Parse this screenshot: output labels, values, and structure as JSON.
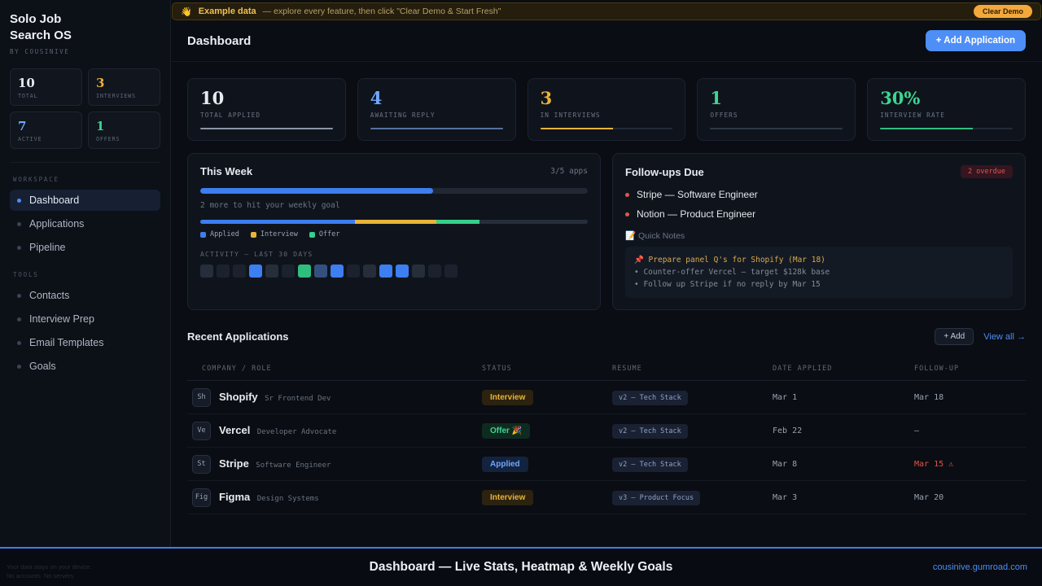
{
  "sidebar": {
    "title_line1": "Solo Job",
    "title_line2": "Search OS",
    "byline": "BY COUSINIVE",
    "stats": [
      {
        "value": "10",
        "label": "TOTAL",
        "color": "#e7eaf0"
      },
      {
        "value": "3",
        "label": "INTERVIEWS",
        "color": "#e8b339"
      },
      {
        "value": "7",
        "label": "ACTIVE",
        "color": "#6ea8fe"
      },
      {
        "value": "1",
        "label": "OFFERS",
        "color": "#3bd68f"
      }
    ],
    "sections": [
      {
        "heading": "WORKSPACE",
        "items": [
          {
            "label": "Dashboard",
            "active": true
          },
          {
            "label": "Applications",
            "active": false
          },
          {
            "label": "Pipeline",
            "active": false
          }
        ]
      },
      {
        "heading": "TOOLS",
        "items": [
          {
            "label": "Contacts",
            "active": false
          },
          {
            "label": "Interview Prep",
            "active": false
          },
          {
            "label": "Email Templates",
            "active": false
          },
          {
            "label": "Goals",
            "active": false
          }
        ]
      }
    ],
    "footnote_line1": "Your data stays on your device.",
    "footnote_line2": "No accounts. No servers."
  },
  "banner": {
    "emoji": "👋",
    "title": "Example data",
    "message": "— explore every feature, then click \"Clear Demo & Start Fresh\"",
    "button": "Clear Demo"
  },
  "header": {
    "title": "Dashboard",
    "add_button": "+ Add Application"
  },
  "stat_cards": [
    {
      "value": "10",
      "label": "TOTAL APPLIED",
      "color": "#e7eaf0",
      "bar_color": "#8b95a5",
      "bar_pct": 100
    },
    {
      "value": "4",
      "label": "AWAITING REPLY",
      "color": "#6ea8fe",
      "bar_color": "#54729e",
      "bar_pct": 100
    },
    {
      "value": "3",
      "label": "IN INTERVIEWS",
      "color": "#e8b339",
      "bar_color": "#e8b339",
      "bar_pct": 55
    },
    {
      "value": "1",
      "label": "OFFERS",
      "color": "#3bd68f",
      "bar_color": "#2d3846",
      "bar_pct": 100
    },
    {
      "value": "30%",
      "label": "INTERVIEW RATE",
      "color": "#3bd68f",
      "bar_color": "#2fbe7e",
      "bar_pct": 70
    }
  ],
  "this_week": {
    "title": "This Week",
    "counter": "3/5 apps",
    "progress_pct": 60,
    "hint": "2 more to hit your weekly goal",
    "breakdown": [
      {
        "color": "#3d7ef0",
        "pct": 40
      },
      {
        "color": "#e8b339",
        "pct": 21
      },
      {
        "color": "#35d08a",
        "pct": 11
      },
      {
        "color": "#262e3b",
        "pct": 28
      }
    ],
    "legend": [
      {
        "label": "Applied",
        "color": "#3d7ef0"
      },
      {
        "label": "Interview",
        "color": "#e8b339"
      },
      {
        "label": "Offer",
        "color": "#35d08a"
      }
    ],
    "activity_label": "ACTIVITY — LAST 30 DAYS",
    "activity_levels": [
      1,
      0,
      0,
      3,
      1,
      0,
      4,
      2,
      3,
      0,
      1,
      3,
      3,
      1,
      0,
      0
    ],
    "activity_palette": {
      "0": "#1c222d",
      "1": "#262e3b",
      "2": "#33507f",
      "3": "#3d7ef0",
      "4": "#2fbe7e"
    }
  },
  "followups": {
    "title": "Follow-ups Due",
    "badge": "2 overdue",
    "items": [
      "Stripe — Software Engineer",
      "Notion — Product Engineer"
    ],
    "notes_title": "📝 Quick Notes",
    "notes": [
      {
        "text": "📌 Prepare panel Q's for Shopify (Mar 18)",
        "highlight": true
      },
      {
        "text": "• Counter-offer Vercel — target $128k base",
        "highlight": false
      },
      {
        "text": "• Follow up Stripe if no reply by Mar 15",
        "highlight": false
      }
    ]
  },
  "recent": {
    "title": "Recent Applications",
    "add_button": "+ Add",
    "view_all": "View all →",
    "columns": [
      "COMPANY / ROLE",
      "STATUS",
      "RESUME",
      "DATE APPLIED",
      "FOLLOW-UP"
    ],
    "rows": [
      {
        "initials": "Sh",
        "company": "Shopify",
        "role": "Sr Frontend Dev",
        "status": "Interview",
        "status_type": "interview",
        "resume": "v2 – Tech Stack",
        "date": "Mar 1",
        "followup": "Mar 18",
        "overdue": false
      },
      {
        "initials": "Ve",
        "company": "Vercel",
        "role": "Developer Advocate",
        "status": "Offer 🎉",
        "status_type": "offer",
        "resume": "v2 – Tech Stack",
        "date": "Feb 22",
        "followup": "—",
        "overdue": false
      },
      {
        "initials": "St",
        "company": "Stripe",
        "role": "Software Engineer",
        "status": "Applied",
        "status_type": "applied",
        "resume": "v2 – Tech Stack",
        "date": "Mar 8",
        "followup": "Mar 15 ⚠",
        "overdue": true
      },
      {
        "initials": "Fig",
        "company": "Figma",
        "role": "Design Systems",
        "status": "Interview",
        "status_type": "interview",
        "resume": "v3 – Product Focus",
        "date": "Mar 3",
        "followup": "Mar 20",
        "overdue": false
      }
    ]
  },
  "footer": {
    "title": "Dashboard — Live Stats, Heatmap & Weekly Goals",
    "link": "cousinive.gumroad.com"
  }
}
